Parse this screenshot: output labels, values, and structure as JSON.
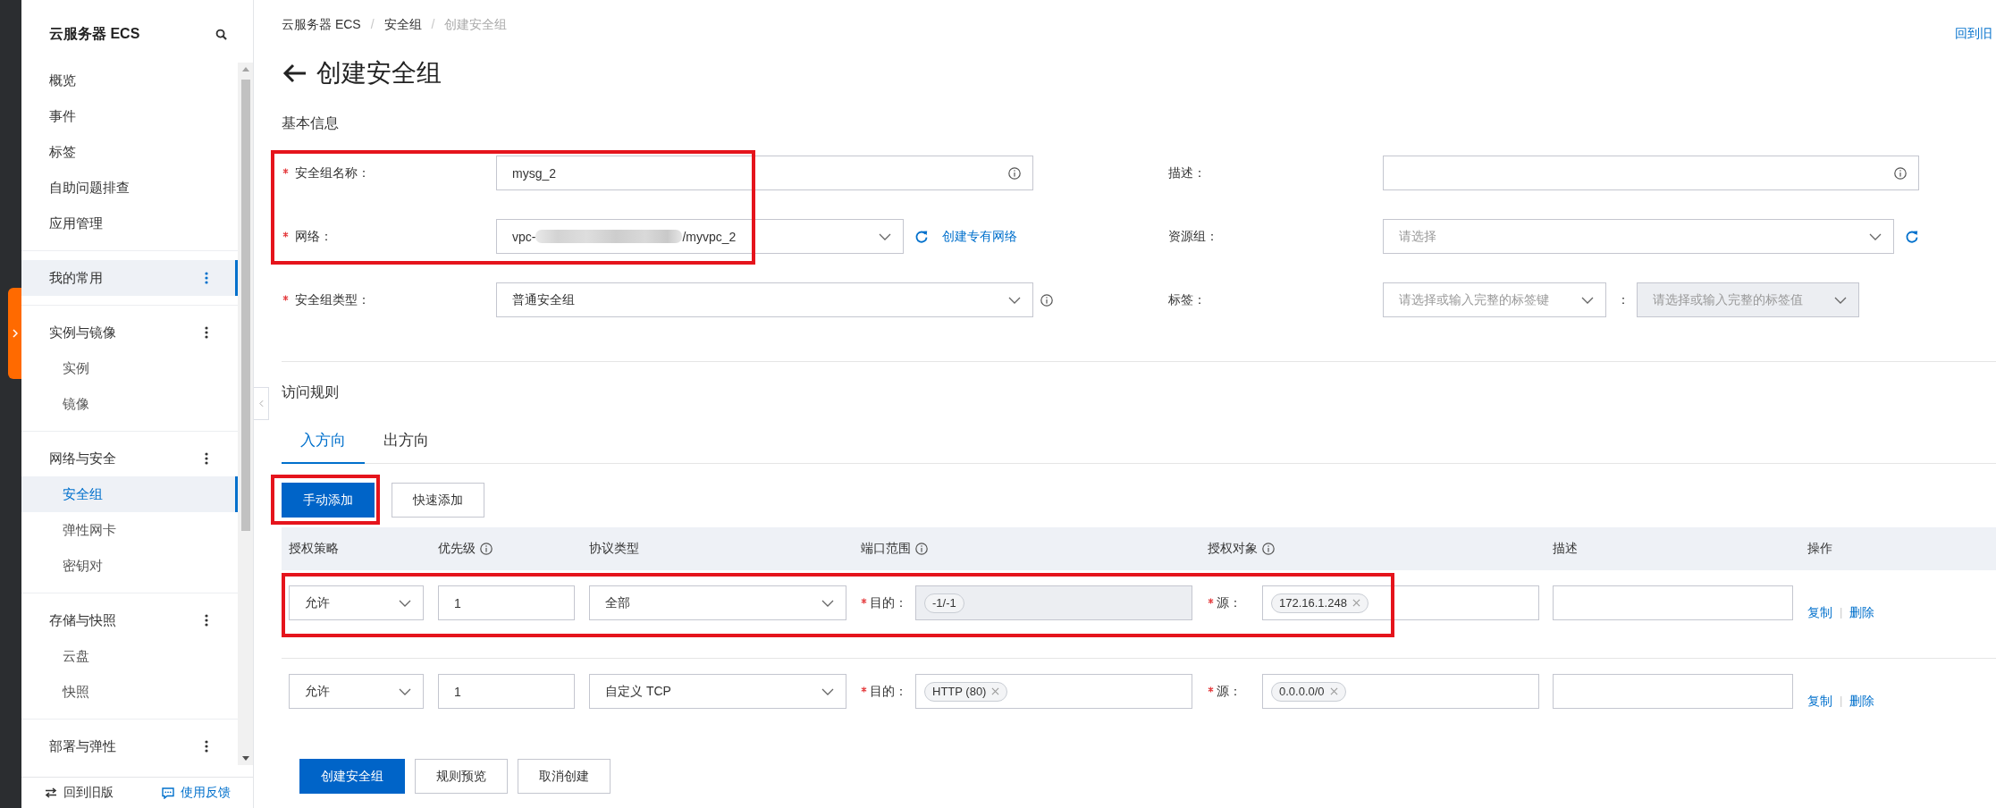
{
  "sidebar": {
    "title": "云服务器 ECS",
    "items": [
      {
        "label": "概览",
        "selected": false
      },
      {
        "label": "事件",
        "selected": false
      },
      {
        "label": "标签",
        "selected": false
      },
      {
        "label": "自助问题排查",
        "selected": false
      },
      {
        "label": "应用管理",
        "selected": false
      }
    ],
    "sections": [
      {
        "label": "我的常用",
        "selected": true
      },
      {
        "label": "实例与镜像",
        "selected": false,
        "children": [
          {
            "label": "实例",
            "selected": false
          },
          {
            "label": "镜像",
            "selected": false
          }
        ]
      },
      {
        "label": "网络与安全",
        "selected": false,
        "children": [
          {
            "label": "安全组",
            "selected": true
          },
          {
            "label": "弹性网卡",
            "selected": false
          },
          {
            "label": "密钥对",
            "selected": false
          }
        ]
      },
      {
        "label": "存储与快照",
        "selected": false,
        "children": [
          {
            "label": "云盘",
            "selected": false
          },
          {
            "label": "快照",
            "selected": false
          }
        ]
      },
      {
        "label": "部署与弹性",
        "selected": false
      }
    ],
    "footer": [
      {
        "kind": "switch",
        "label": "回到旧版"
      },
      {
        "kind": "feedback",
        "label": "使用反馈"
      }
    ]
  },
  "breadcrumb": [
    {
      "kind": "link",
      "label": "云服务器 ECS"
    },
    {
      "kind": "separator",
      "label": "/"
    },
    {
      "kind": "link",
      "label": "安全组"
    },
    {
      "kind": "separator",
      "label": "/"
    },
    {
      "kind": "current",
      "label": "创建安全组"
    }
  ],
  "top_link": "回到旧",
  "page_title": "创建安全组",
  "basic_info": {
    "heading": "基本信息",
    "left_fields": [
      {
        "kind": "input",
        "label": "安全组名称：",
        "required": true,
        "value": "mysg_2",
        "info": true
      },
      {
        "kind": "select",
        "label": "网络：",
        "required": true,
        "value": "vpc-",
        "redacted": true,
        "value_end": "/myvpc_2",
        "refresh": true,
        "link": "创建专有网络"
      },
      {
        "kind": "select",
        "label": "安全组类型：",
        "required": true,
        "value": "普通安全组",
        "info": true
      }
    ],
    "right_fields": [
      {
        "kind": "input",
        "label": "描述：",
        "info": true
      },
      {
        "kind": "select",
        "label": "资源组：",
        "placeholder": "请选择",
        "refresh": true
      },
      {
        "kind": "tag_pair",
        "label": "标签：",
        "key_placeholder": "请选择或输入完整的标签键",
        "separator": "：",
        "value_placeholder": "请选择或输入完整的标签值",
        "value_disabled": true
      }
    ]
  },
  "access_rules": {
    "heading": "访问规则",
    "tabs": [
      {
        "label": "入方向",
        "selected": true
      },
      {
        "label": "出方向",
        "selected": false
      }
    ],
    "buttons": [
      {
        "kind": "primary",
        "label": "手动添加"
      },
      {
        "kind": "default",
        "label": "快速添加"
      }
    ],
    "table": {
      "columns": [
        {
          "label": "授权策略"
        },
        {
          "label": "优先级",
          "info": true
        },
        {
          "label": "协议类型"
        },
        {
          "label": "端口范围",
          "info": true
        },
        {
          "label": "授权对象",
          "info": true
        },
        {
          "label": "描述"
        },
        {
          "label": "操作"
        }
      ],
      "rows": [
        {
          "policy": "允许",
          "priority": "1",
          "protocol": "全部",
          "port": {
            "label": "目的：",
            "required": true,
            "disabled": true,
            "tags": [
              {
                "text": "-1/-1",
                "removable": false
              }
            ]
          },
          "source": {
            "label": "源：",
            "required": true,
            "disabled": false,
            "tags": [
              {
                "text": "172.16.1.248",
                "removable": true
              }
            ]
          },
          "actions": [
            {
              "kind": "link",
              "label": "复制"
            },
            {
              "kind": "separator",
              "label": "|"
            },
            {
              "kind": "link",
              "label": "删除"
            }
          ]
        },
        {
          "policy": "允许",
          "priority": "1",
          "protocol": "自定义 TCP",
          "port": {
            "label": "目的：",
            "required": true,
            "disabled": false,
            "tags": [
              {
                "text": "HTTP (80)",
                "removable": true
              }
            ]
          },
          "source": {
            "label": "源：",
            "required": true,
            "disabled": false,
            "tags": [
              {
                "text": "0.0.0.0/0",
                "removable": true
              }
            ]
          },
          "actions": [
            {
              "kind": "link",
              "label": "复制"
            },
            {
              "kind": "separator",
              "label": "|"
            },
            {
              "kind": "link",
              "label": "删除"
            }
          ]
        }
      ]
    }
  },
  "footer_buttons": [
    {
      "kind": "primary",
      "label": "创建安全组"
    },
    {
      "kind": "default",
      "label": "规则预览"
    },
    {
      "kind": "default",
      "label": "取消创建"
    }
  ]
}
